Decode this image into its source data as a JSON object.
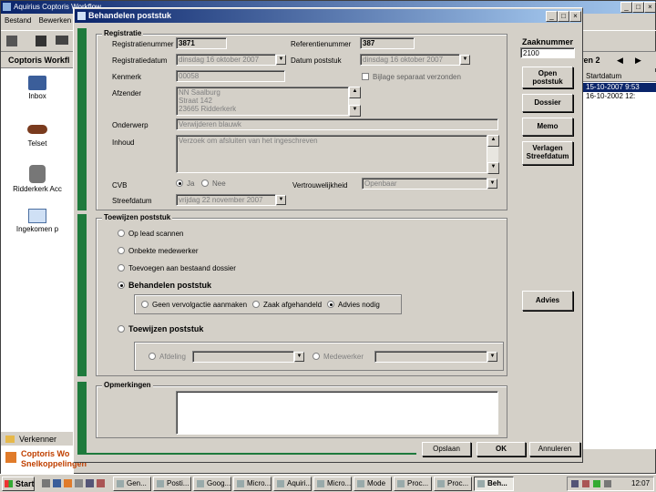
{
  "bg_window": {
    "title": "Aquirius   Coptoris Workflow",
    "menu": [
      "Bestand",
      "Bewerken"
    ],
    "nav_title": "Coptoris Workfl",
    "nav_items": [
      "Inbox",
      "Telset",
      "Ridderkerk Acc",
      "Ingekomen p"
    ],
    "right_header": "ren 2",
    "col_header": "Startdatum",
    "rows": [
      "15-10-2007 9:53",
      "16-10-2002 12:"
    ],
    "verkenner": "Verkenner",
    "bottom_title": "Coptoris Wo",
    "bottom_sub": "Snelkoppelingen"
  },
  "dialog": {
    "title": "Behandelen poststuk",
    "registratie": {
      "group_title": "Registratie",
      "registratienummer_label": "Registratienummer",
      "registratienummer": "3871",
      "referentienummer_label": "Referentienummer",
      "referentienummer": "387",
      "registratiedatum_label": "Registratiedatum",
      "registratiedatum": "dinsdag   16   oktober   2007",
      "datum_poststuk_label": "Datum poststuk",
      "datum_poststuk": "dinsdag   16   oktober   2007",
      "kenmerk_label": "Kenmerk",
      "kenmerk": "00058",
      "bijlage_label": "Bijlage separaat verzonden",
      "afzender_label": "Afzender",
      "afzender_lines": [
        "NN Saalburg",
        "Straat 142",
        "23665  Ridderkerk"
      ],
      "onderwerp_label": "Onderwerp",
      "onderwerp": "Verwijderen blauwk",
      "inhoud_label": "Inhoud",
      "inhoud": "Verzoek om afsluiten van het ingeschreven",
      "cvb_label": "CVB",
      "cvb_ja": "Ja",
      "cvb_nee": "Nee",
      "vertrouwelijkheid_label": "Vertrouwelijkheid",
      "vertrouwelijkheid": "Openbaar",
      "streefdatum_label": "Streefdatum",
      "streefdatum": "vrijdag   22   november   2007"
    },
    "toewijzen": {
      "group_title": "Toewijzen poststuk",
      "options": [
        "Op lead scannen",
        "Onbekte medewerker",
        "Toevoegen aan bestaand dossier",
        "Behandelen poststuk",
        "Toewijzen poststuk"
      ],
      "sub_options": [
        "Geen vervolgactie aanmaken",
        "Zaak afgehandeld",
        "Advies nodig"
      ],
      "afdeling_label": "Afdeling",
      "medewerker_label": "Medewerker"
    },
    "opmerkingen": {
      "group_title": "Opmerkingen"
    },
    "side": {
      "zaaknummer_label": "Zaaknummer",
      "zaaknummer": "2100",
      "open_poststuk": "Open poststuk",
      "dossier": "Dossier",
      "memo": "Memo",
      "verlagen_streefdatum": "Verlagen Streefdatum",
      "advies": "Advies"
    },
    "footer": {
      "opslaan": "Opslaan",
      "ok": "OK",
      "annuleren": "Annuleren"
    }
  },
  "taskbar": {
    "start": "Start",
    "items": [
      "Gen...",
      "Posti...",
      "Goog...",
      "Micro...",
      "Aquiri...",
      "Micro...",
      "Mode",
      "Proc...",
      "Proc...",
      "Beh..."
    ],
    "clock": "12:07"
  },
  "colors": {
    "accent_green": "#1e7a3c",
    "title_blue": "#0a246a",
    "face": "#d4d0c8"
  }
}
